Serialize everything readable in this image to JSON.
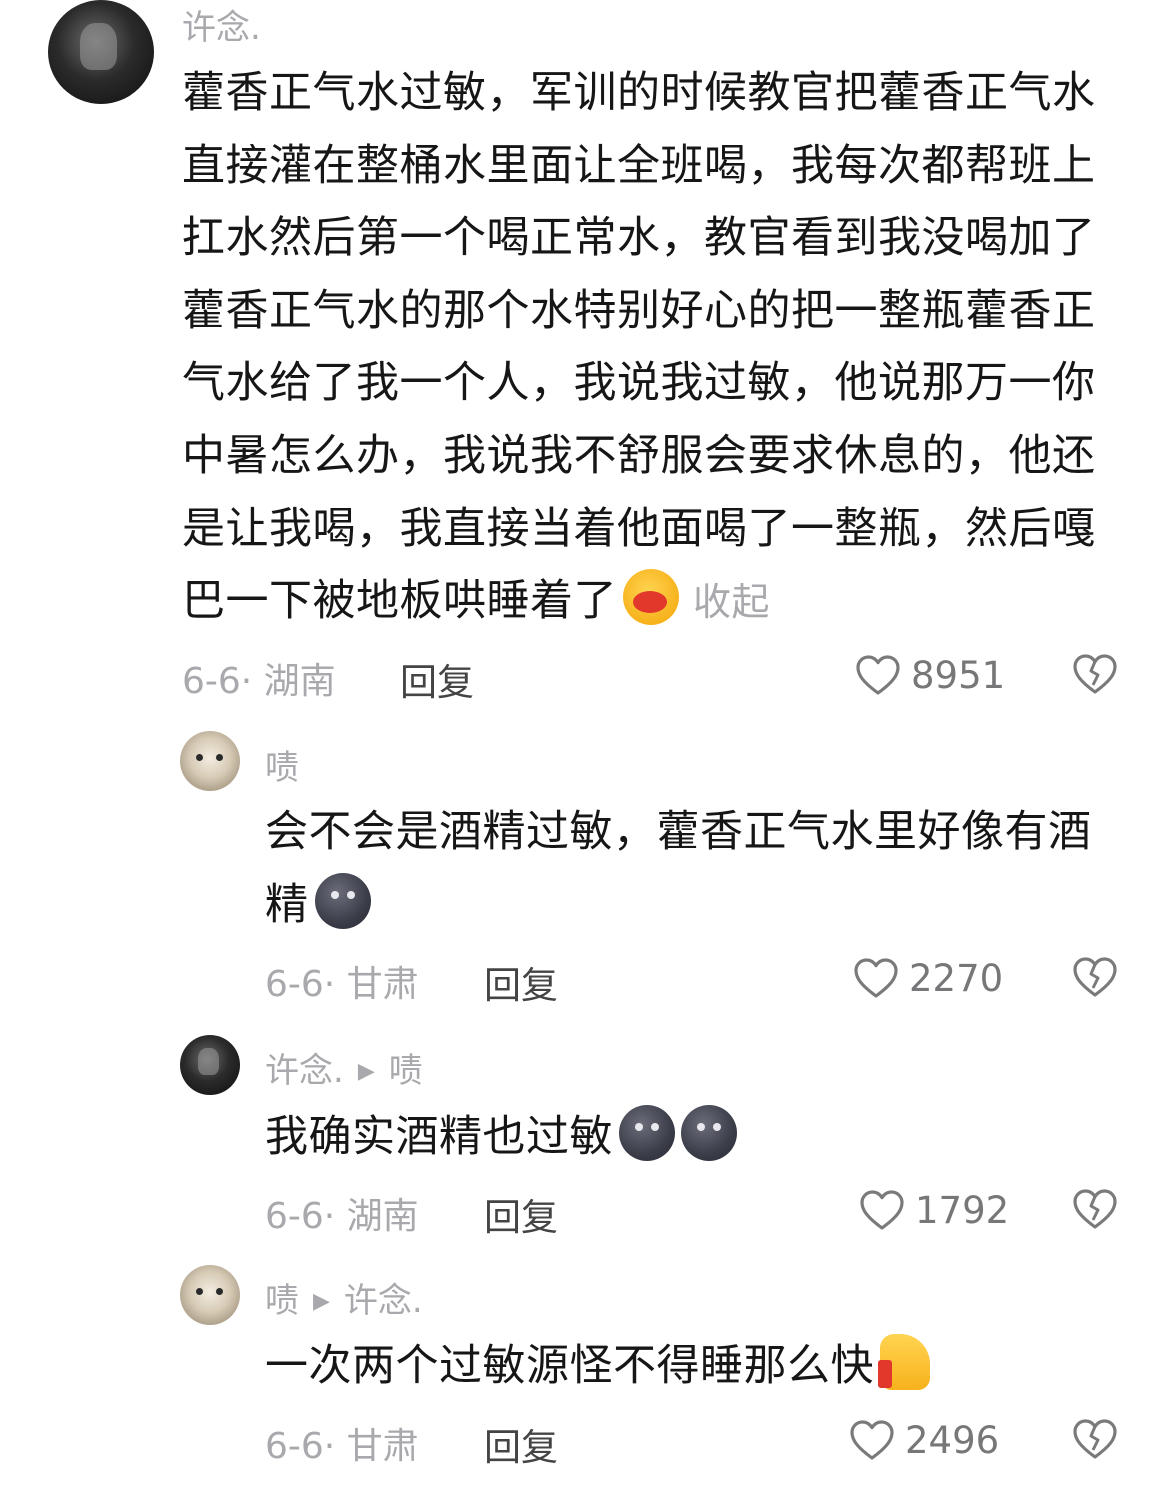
{
  "comments": [
    {
      "author": "许念.",
      "reply_to": "",
      "lines": [
        "藿香正气水过敏，军训的时候教官把藿香正气水",
        "直接灌在整桶水里面让全班喝，我每次都帮班上",
        "扛水然后第一个喝正常水，教官看到我没喝加了",
        "藿香正气水的那个水特别好心的把一整瓶藿香正",
        "气水给了我一个人，我说我过敏，他说那万一你",
        "中暑怎么办，我说我不舒服会要求休息的，他还",
        "是让我喝，我直接当着他面喝了一整瓶，然后嘎",
        "巴一下被地板哄睡着了"
      ],
      "emoji": "kiss-face-emoji",
      "collapse_label": "收起",
      "meta": "6-6· 湖南",
      "reply_label": "回复",
      "likes": "8951"
    },
    {
      "author": "啧",
      "lines": [
        "会不会是酒精过敏，藿香正气水里好像有酒",
        "精"
      ],
      "emoji": "moon-face-emoji",
      "meta": "6-6· 甘肃",
      "reply_label": "回复",
      "likes": "2270"
    },
    {
      "author": "许念.",
      "reply_to": "啧",
      "lines": [
        "我确实酒精也过敏"
      ],
      "emoji": "moon-face-emoji x2",
      "meta": "6-6· 湖南",
      "reply_label": "回复",
      "likes": "1792"
    },
    {
      "author": "啧",
      "reply_to": "许念.",
      "lines": [
        "一次两个过敏源怪不得睡那么快"
      ],
      "emoji": "thumbs-up-emoji",
      "meta": "6-6· 甘肃",
      "reply_label": "回复",
      "likes": "2496"
    }
  ],
  "colors": {
    "text": "#161616",
    "muted": "#a9a9ad",
    "reply": "#444446"
  },
  "icons": {
    "like": "heart-outline-icon",
    "dislike": "broken-heart-icon",
    "reply_arrow": "triangle-right-icon"
  }
}
